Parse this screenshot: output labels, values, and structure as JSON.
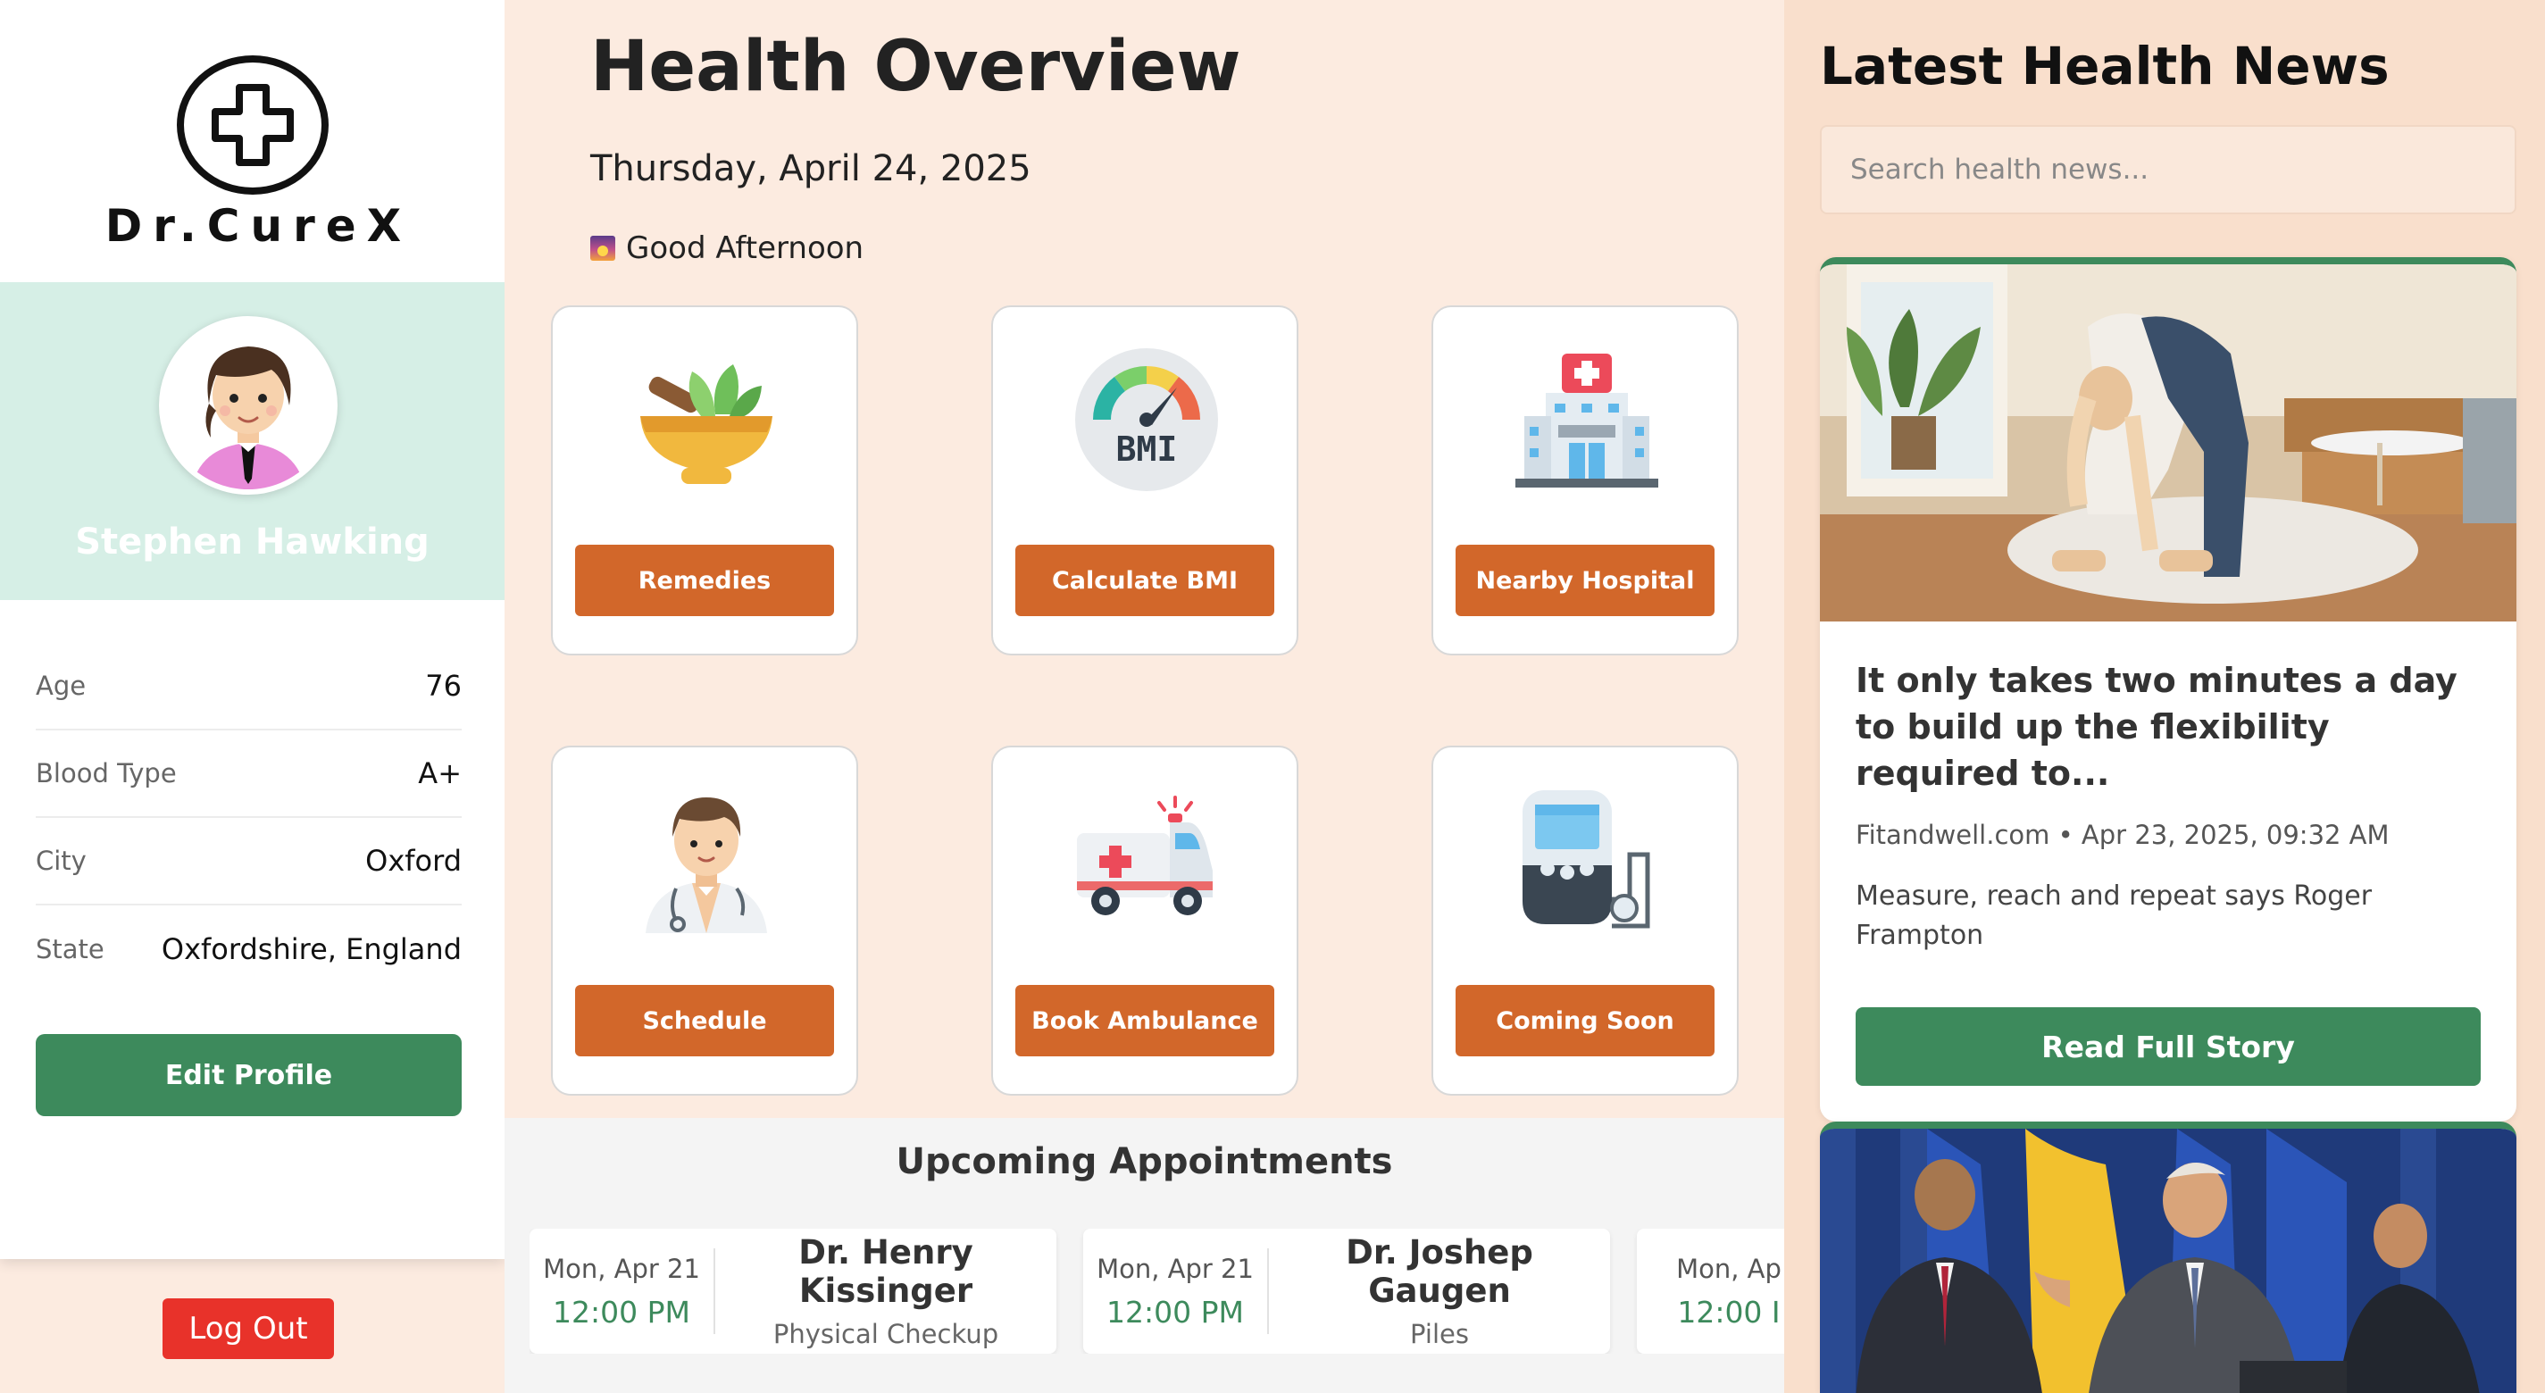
{
  "brand": {
    "name": "Dr.CureX"
  },
  "profile": {
    "name": "Stephen Hawking",
    "fields": [
      {
        "label": "Age",
        "value": "76"
      },
      {
        "label": "Blood Type",
        "value": "A+"
      },
      {
        "label": "City",
        "value": "Oxford"
      },
      {
        "label": "State",
        "value": "Oxfordshire, England"
      }
    ],
    "edit_label": "Edit Profile",
    "logout_label": "Log Out"
  },
  "overview": {
    "title": "Health Overview",
    "date": "Thursday, April 24, 2025",
    "greeting": "Good Afternoon",
    "tiles": [
      {
        "label": "Remedies",
        "icon": "mortar-herb-icon"
      },
      {
        "label": "Calculate BMI",
        "icon": "bmi-gauge-icon"
      },
      {
        "label": "Nearby Hospital",
        "icon": "hospital-icon"
      },
      {
        "label": "Schedule",
        "icon": "doctor-icon"
      },
      {
        "label": "Book Ambulance",
        "icon": "ambulance-icon"
      },
      {
        "label": "Coming Soon",
        "icon": "blood-pressure-monitor-icon"
      }
    ]
  },
  "appointments": {
    "title": "Upcoming Appointments",
    "items": [
      {
        "date": "Mon, Apr 21",
        "time": "12:00 PM",
        "doctor": "Dr. Henry Kissinger",
        "type": "Physical Checkup"
      },
      {
        "date": "Mon, Apr 21",
        "time": "12:00 PM",
        "doctor": "Dr. Joshep Gaugen",
        "type": "Piles"
      },
      {
        "date": "Mon, Ap",
        "time": "12:00 I",
        "doctor": "",
        "type": ""
      }
    ]
  },
  "news": {
    "title": "Latest Health News",
    "search_placeholder": "Search health news...",
    "articles": [
      {
        "headline": "It only takes two minutes a day to build up the flexibility required to...",
        "meta": "Fitandwell.com • Apr 23, 2025, 09:32 AM",
        "description": "Measure, reach and repeat says Roger Frampton",
        "read_label": "Read Full Story"
      }
    ]
  },
  "colors": {
    "accent_green": "#3d8a5c",
    "tile_button": "#d2672a",
    "logout_red": "#e8322a",
    "page_bg": "#fcebe0",
    "news_bg": "#f9dfcc"
  }
}
